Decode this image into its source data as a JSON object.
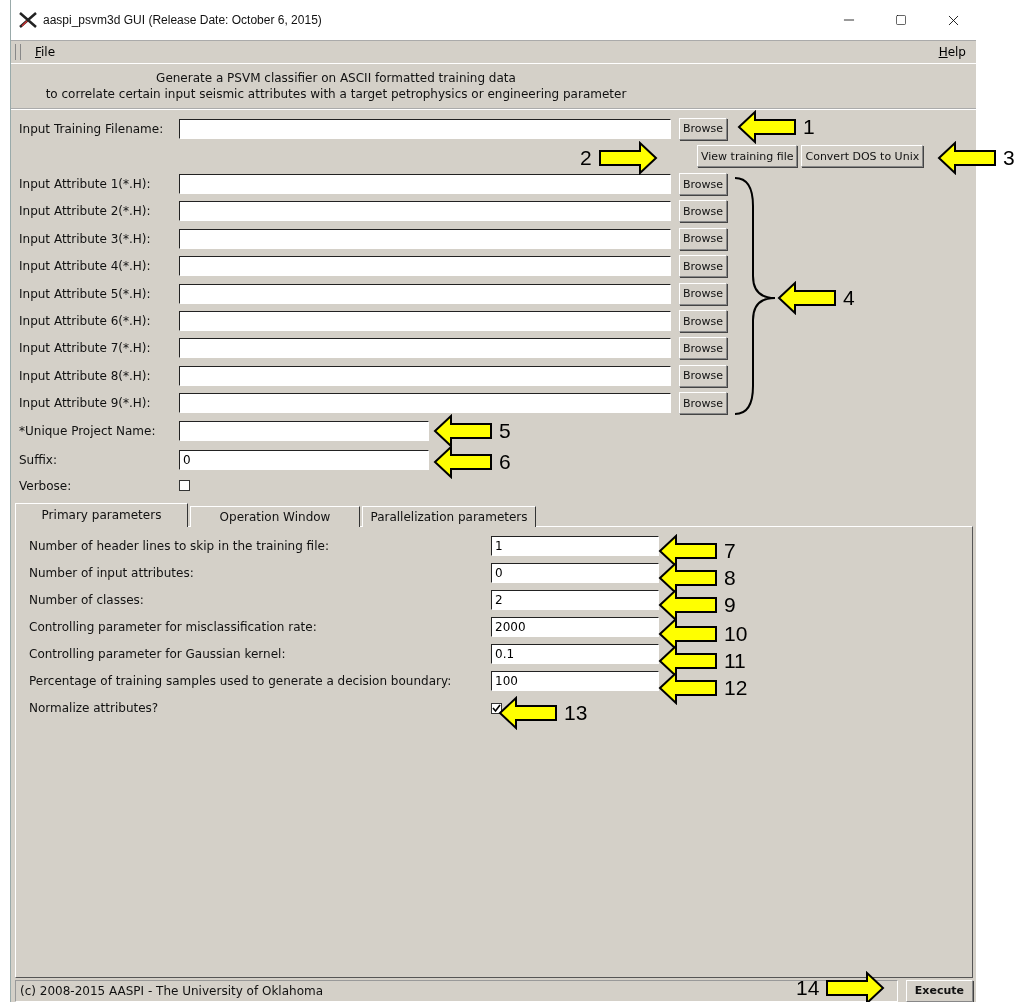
{
  "window": {
    "title": "aaspi_psvm3d GUI (Release Date: October 6, 2015)"
  },
  "menu": [
    {
      "label": "File"
    },
    {
      "label": "Help"
    }
  ],
  "header": [
    "Generate a PSVM classifier on ASCII formatted training data",
    "to correlate certain input seismic attributes with a target petrophysics or engineering parameter"
  ],
  "training_file": {
    "label": "Input Training Filename:",
    "button": "Browse"
  },
  "file_actions": [
    "View training file",
    "Convert DOS to Unix"
  ],
  "attributes": [
    {
      "label": "Input Attribute 1(*.H):",
      "button": "Browse"
    },
    {
      "label": "Input Attribute 2(*.H):",
      "button": "Browse"
    },
    {
      "label": "Input Attribute 3(*.H):",
      "button": "Browse"
    },
    {
      "label": "Input Attribute 4(*.H):",
      "button": "Browse"
    },
    {
      "label": "Input Attribute 5(*.H):",
      "button": "Browse"
    },
    {
      "label": "Input Attribute 6(*.H):",
      "button": "Browse"
    },
    {
      "label": "Input Attribute 7(*.H):",
      "button": "Browse"
    },
    {
      "label": "Input Attribute 8(*.H):",
      "button": "Browse"
    },
    {
      "label": "Input Attribute 9(*.H):",
      "button": "Browse"
    }
  ],
  "project_name": {
    "label": "*Unique Project Name:"
  },
  "suffix": {
    "label": "Suffix:",
    "value": "0"
  },
  "verbose": {
    "label": "Verbose:",
    "checked": false
  },
  "tabs": [
    {
      "label": "Primary parameters",
      "selected": true
    },
    {
      "label": "Operation Window",
      "selected": false
    },
    {
      "label": "Parallelization parameters",
      "selected": false
    }
  ],
  "parameters": [
    {
      "kind": "field",
      "label": "Number of header lines to skip in the training file:",
      "value": "1"
    },
    {
      "kind": "field",
      "label": "Number of input attributes:",
      "value": "0"
    },
    {
      "kind": "field",
      "label": "Number of classes:",
      "value": "2"
    },
    {
      "kind": "field",
      "label": "Controlling parameter for misclassification rate:",
      "value": "2000"
    },
    {
      "kind": "field",
      "label": "Controlling parameter for Gaussian kernel:",
      "value": "0.1"
    },
    {
      "kind": "field",
      "label": "Percentage of training samples used to generate a decision boundary:",
      "value": "100"
    },
    {
      "kind": "checkbox",
      "label": "Normalize attributes?",
      "checked": true
    }
  ],
  "status_bar": {
    "text": "(c) 2008-2015 AASPI - The University of Oklahoma",
    "button": "Execute"
  },
  "callouts": [
    {
      "label": "1",
      "kind": "left"
    },
    {
      "label": "2",
      "kind": "right"
    },
    {
      "label": "3",
      "kind": "left"
    },
    {
      "label": "4",
      "kind": "left"
    },
    {
      "label": "5",
      "kind": "left"
    },
    {
      "label": "6",
      "kind": "left"
    },
    {
      "label": "7",
      "kind": "left"
    },
    {
      "label": "8",
      "kind": "left"
    },
    {
      "label": "9",
      "kind": "left"
    },
    {
      "label": "10",
      "kind": "left"
    },
    {
      "label": "11",
      "kind": "left"
    },
    {
      "label": "12",
      "kind": "left"
    },
    {
      "label": "13",
      "kind": "left"
    },
    {
      "label": "14",
      "kind": "right"
    }
  ]
}
